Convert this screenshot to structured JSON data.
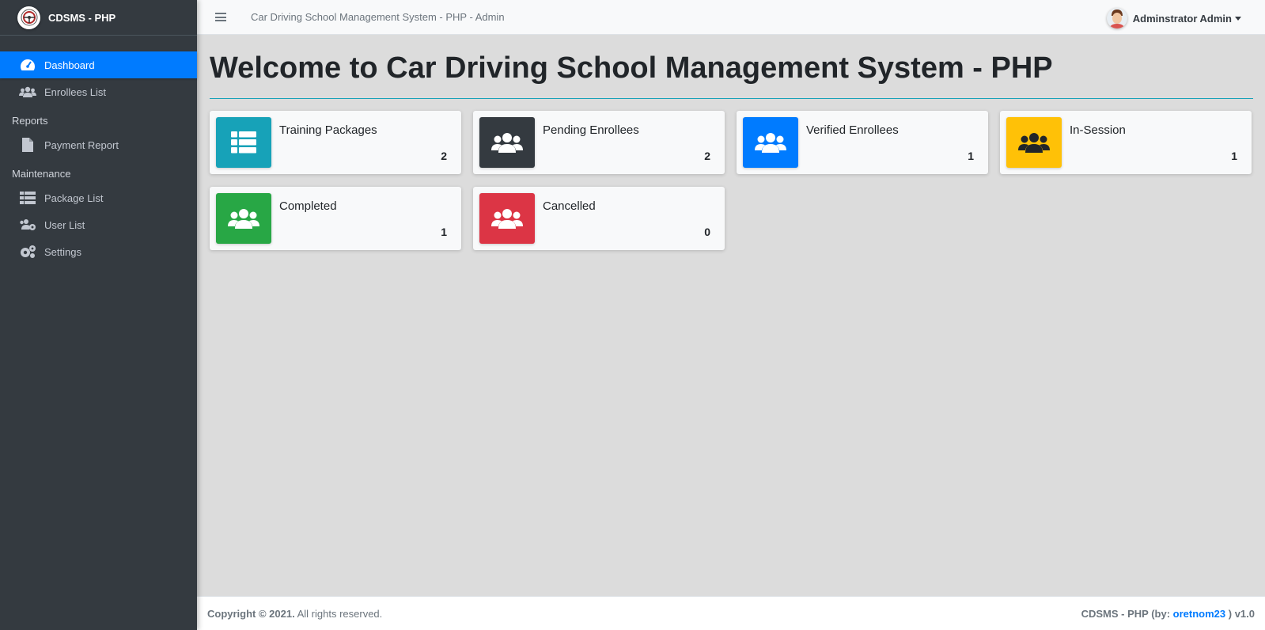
{
  "brand": {
    "name": "CDSMS - PHP",
    "logo_icon": "steering-wheel-logo"
  },
  "topbar": {
    "title": "Car Driving School Management System - PHP - Admin",
    "user_name": "Adminstrator Admin"
  },
  "sidebar": {
    "items": [
      {
        "label": "Dashboard",
        "icon": "tachometer-icon",
        "active": true
      },
      {
        "label": "Enrollees List",
        "icon": "users-icon"
      }
    ],
    "reports_header": "Reports",
    "report_items": [
      {
        "label": "Payment Report",
        "icon": "file-icon"
      }
    ],
    "maintenance_header": "Maintenance",
    "maintenance_items": [
      {
        "label": "Package List",
        "icon": "table-list-icon"
      },
      {
        "label": "User List",
        "icon": "users-cog-icon"
      },
      {
        "label": "Settings",
        "icon": "cogs-icon"
      }
    ]
  },
  "main": {
    "title": "Welcome to Car Driving School Management System - PHP",
    "cards": [
      {
        "label": "Training Packages",
        "value": "2",
        "color": "#17a2b8",
        "icon": "table-list-icon"
      },
      {
        "label": "Pending Enrollees",
        "value": "2",
        "color": "#343a40",
        "icon": "users-icon"
      },
      {
        "label": "Verified Enrollees",
        "value": "1",
        "color": "#007bff",
        "icon": "users-icon"
      },
      {
        "label": "In-Session",
        "value": "1",
        "color": "#ffc107",
        "icon": "users-icon"
      },
      {
        "label": "Completed",
        "value": "1",
        "color": "#28a745",
        "icon": "users-icon"
      },
      {
        "label": "Cancelled",
        "value": "0",
        "color": "#dc3545",
        "icon": "users-icon"
      }
    ]
  },
  "footer": {
    "copyright_prefix": "Copyright © 2021.",
    "copyright_suffix": " All rights reserved.",
    "credit_prefix": "CDSMS - PHP (by: ",
    "credit_author": "oretnom23",
    "credit_suffix": " ) v1.0"
  }
}
